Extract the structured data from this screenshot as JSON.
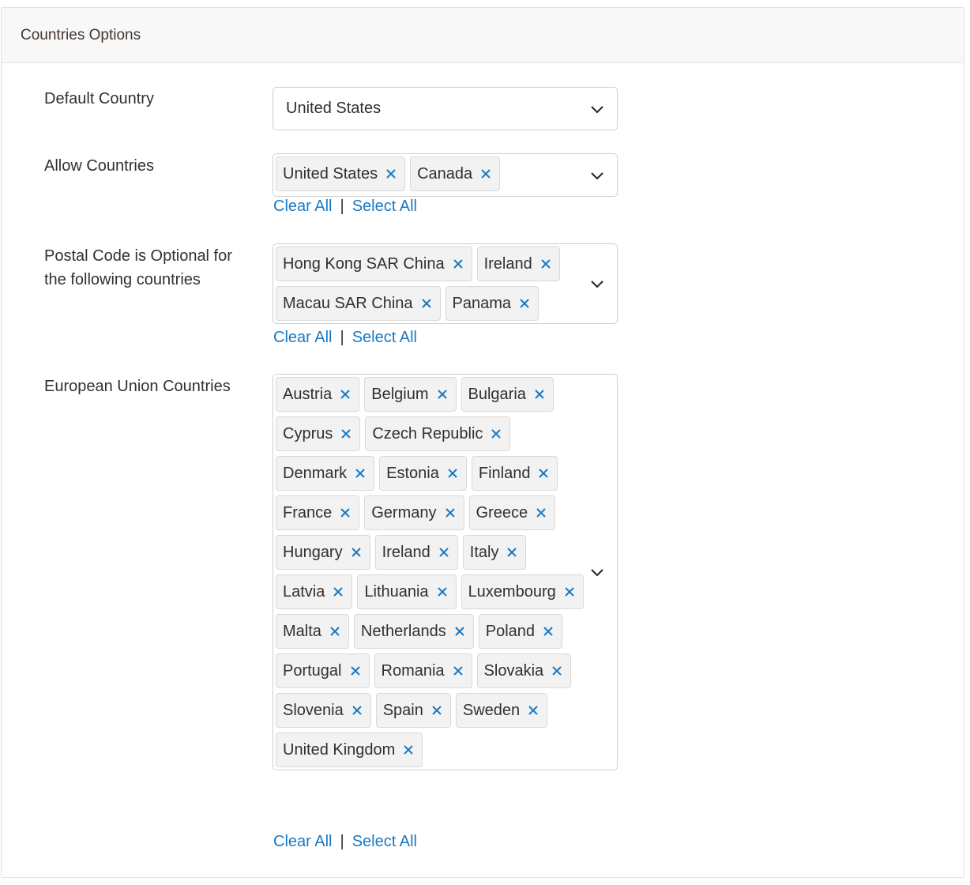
{
  "panel": {
    "title": "Countries Options"
  },
  "default_country": {
    "label": "Default Country",
    "value": "United States"
  },
  "allow_countries": {
    "label": "Allow Countries",
    "chips": [
      "United States",
      "Canada"
    ],
    "clear_all": "Clear All",
    "select_all": "Select All",
    "separator": "|"
  },
  "postal_optional": {
    "label": "Postal Code is Optional for the following countries",
    "chips": [
      "Hong Kong SAR China",
      "Ireland",
      "Macau SAR China",
      "Panama"
    ],
    "clear_all": "Clear All",
    "select_all": "Select All",
    "separator": "|"
  },
  "eu_countries": {
    "label": "European Union Countries",
    "chips": [
      "Austria",
      "Belgium",
      "Bulgaria",
      "Cyprus",
      "Czech Republic",
      "Denmark",
      "Estonia",
      "Finland",
      "France",
      "Germany",
      "Greece",
      "Hungary",
      "Ireland",
      "Italy",
      "Latvia",
      "Lithuania",
      "Luxembourg",
      "Malta",
      "Netherlands",
      "Poland",
      "Portugal",
      "Romania",
      "Slovakia",
      "Slovenia",
      "Spain",
      "Sweden",
      "United Kingdom"
    ],
    "clear_all": "Clear All",
    "select_all": "Select All",
    "separator": "|"
  },
  "icons": {
    "remove": "close-icon",
    "dropdown": "chevron-down-icon"
  },
  "colors": {
    "link": "#1979c3",
    "remove_icon": "#1979c3",
    "chip_bg": "#f2f2f2",
    "header_bg": "#f8f8f8"
  }
}
